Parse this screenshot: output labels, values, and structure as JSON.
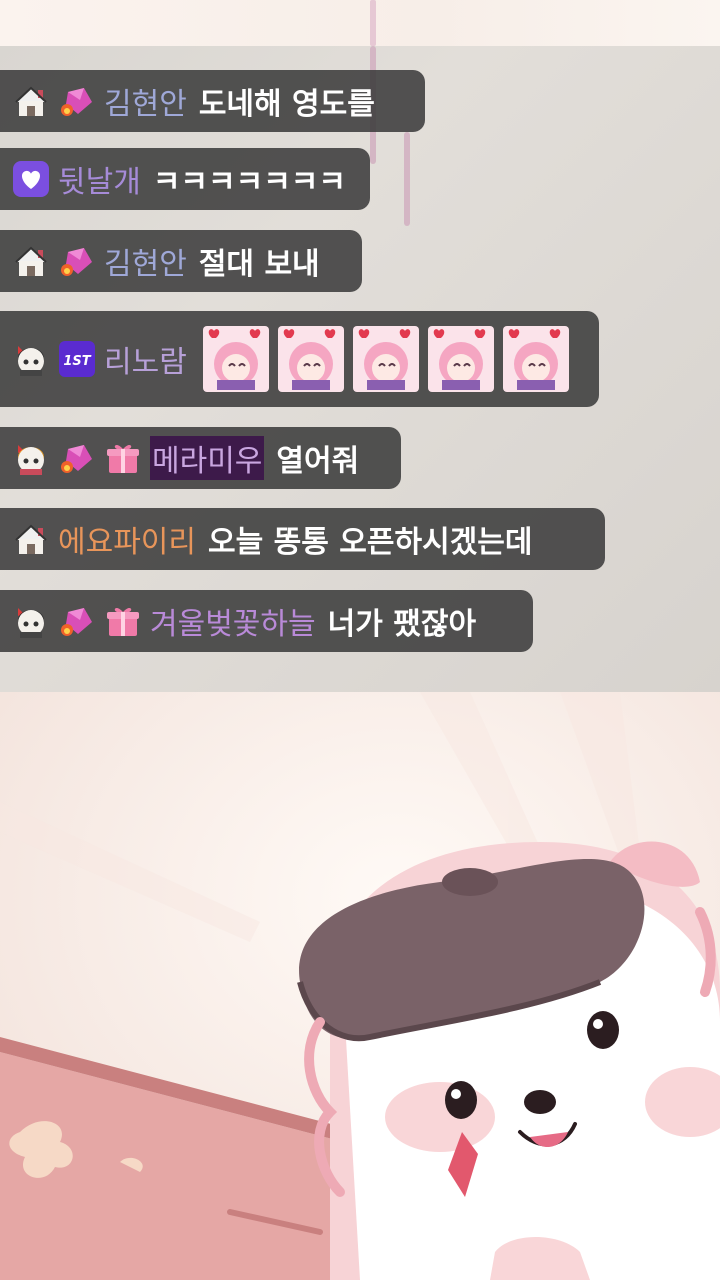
{
  "chat": {
    "messages": [
      {
        "badges": [
          "house-badge",
          "pink-gem-badge"
        ],
        "nick": "김현안",
        "nick_color": "#9fa8d8",
        "text": "도네해 영도를"
      },
      {
        "badges": [
          "purple-heart-badge"
        ],
        "nick": "뒷날개",
        "nick_color": "#a68bd8",
        "text": "ㅋㅋㅋㅋㅋㅋㅋ"
      },
      {
        "badges": [
          "house-badge",
          "pink-gem-badge"
        ],
        "nick": "김현안",
        "nick_color": "#9fa8d8",
        "text": "절대 보내"
      },
      {
        "badges": [
          "panda-badge",
          "1st-badge"
        ],
        "nick": "리노람",
        "nick_color": "#b7a0d8",
        "emote_count": 5
      },
      {
        "badges": [
          "panda-badge",
          "pink-gem-badge",
          "gift-badge"
        ],
        "nick": "메라미우",
        "nick_color": "#c9a6e0",
        "highlighted": true,
        "text": "열어줘"
      },
      {
        "badges": [
          "house-badge"
        ],
        "nick": "에요파이리",
        "nick_color": "#e8955a",
        "text": "오늘 똥통 오픈하시겠는데"
      },
      {
        "badges": [
          "panda-badge",
          "pink-gem-badge",
          "gift-badge"
        ],
        "nick": "겨울벚꽃하늘",
        "nick_color": "#b98ad8",
        "text": "너가 팼잖아"
      }
    ],
    "first_badge_text": "1ST"
  },
  "colors": {
    "chat_bubble_bg": "#3c3c3c",
    "chat_panel_bg": "#dcd8d3",
    "stream_bg": "#f8eee8",
    "hat": "#7a6268",
    "board": "#e5a7a5"
  }
}
